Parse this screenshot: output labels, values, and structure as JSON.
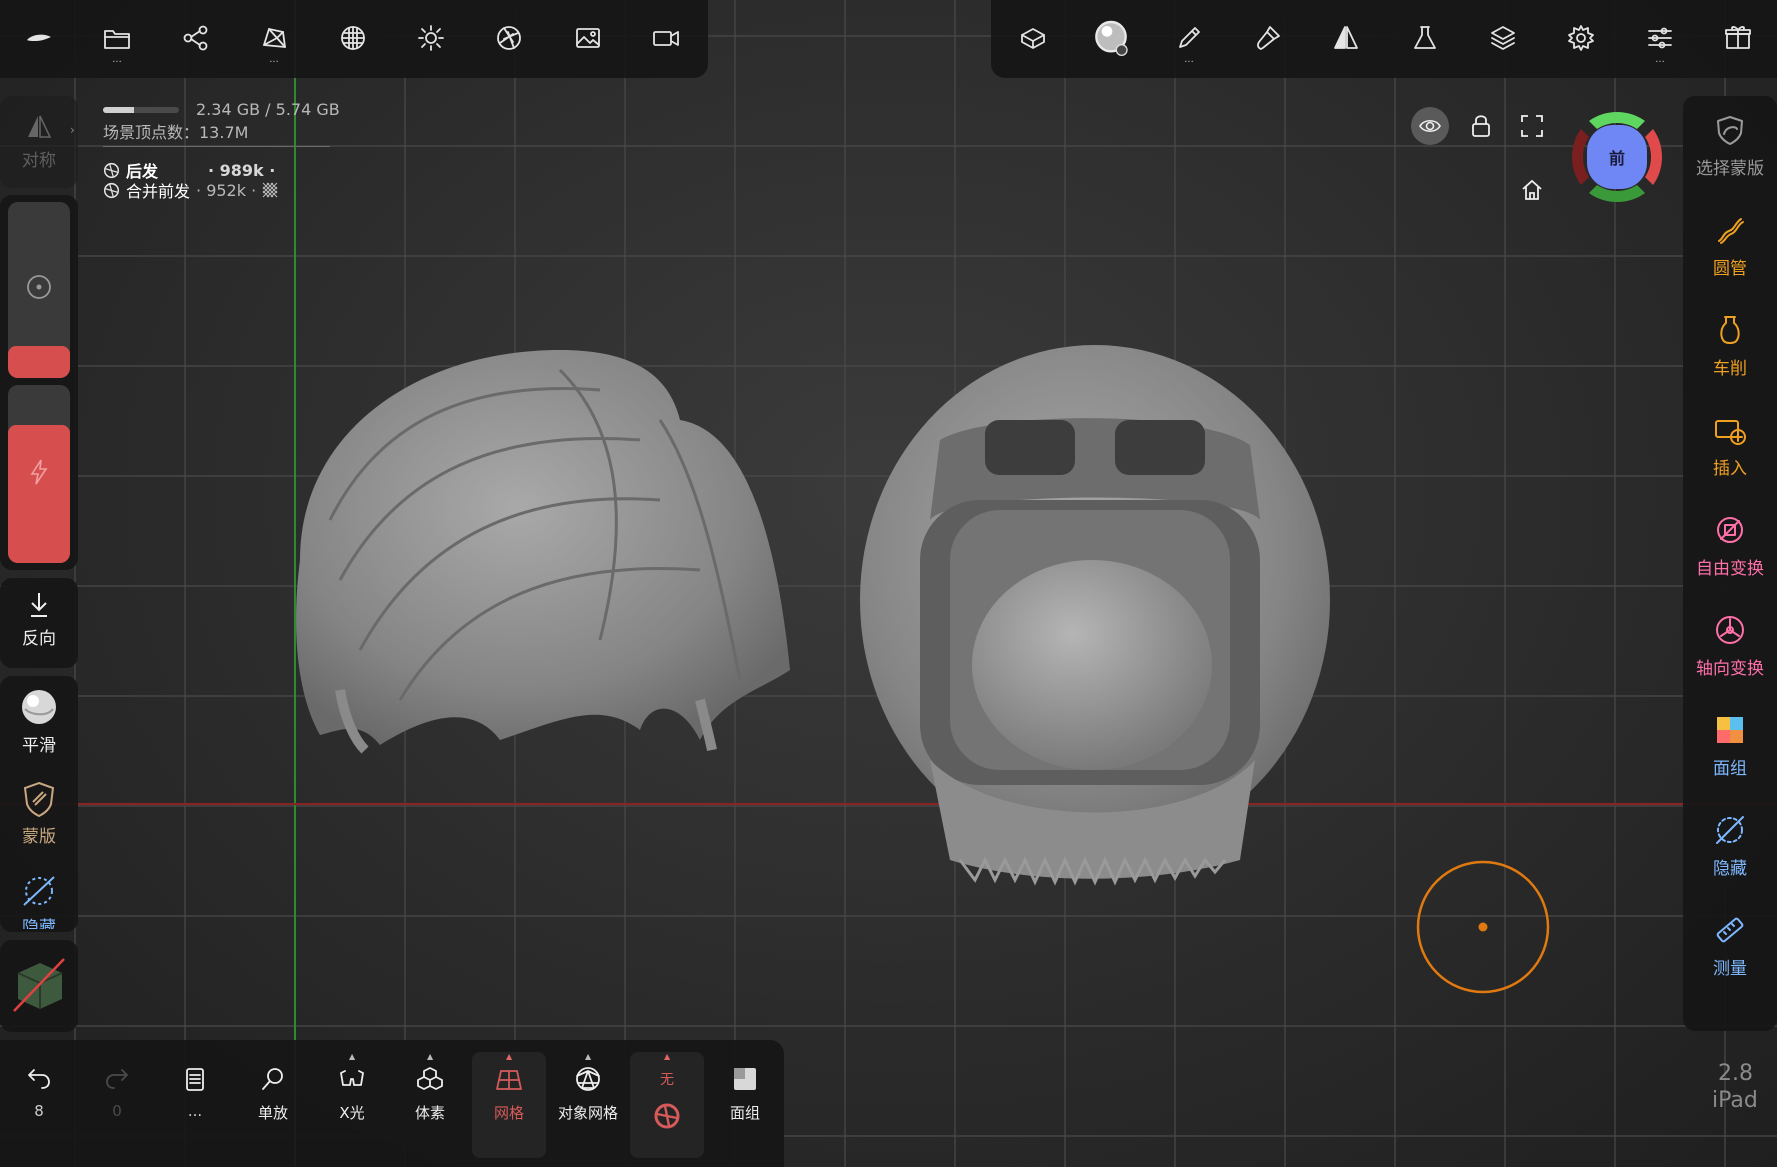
{
  "memory": {
    "text": "2.34 GB / 5.74 GB",
    "used_fraction": 0.41
  },
  "scene_vertices": "场景顶点数：13.7M",
  "meshes": [
    {
      "name": "后发",
      "count": "· 989k ·"
    },
    {
      "name": "合并前发",
      "count": "· 952k ·"
    }
  ],
  "left": {
    "symmetry": "对称",
    "invert": "反向",
    "smooth": "平滑",
    "mask": "蒙版",
    "hide_partial": "隐藏"
  },
  "right_tools": [
    {
      "label": "选择蒙版",
      "icon": "select-mask-icon",
      "color": "#9a9a9a"
    },
    {
      "label": "圆管",
      "icon": "tube-icon",
      "color": "#f0a020"
    },
    {
      "label": "车削",
      "icon": "lathe-icon",
      "color": "#f0a020"
    },
    {
      "label": "插入",
      "icon": "insert-icon",
      "color": "#f0a020"
    },
    {
      "label": "自由变换",
      "icon": "free-transform-icon",
      "color": "#ff6fa8"
    },
    {
      "label": "轴向变换",
      "icon": "axis-transform-icon",
      "color": "#ff6fa8"
    },
    {
      "label": "面组",
      "icon": "face-group-icon",
      "color": "#7db8ff"
    },
    {
      "label": "隐藏",
      "icon": "hide-icon",
      "color": "#7db8ff"
    },
    {
      "label": "测量",
      "icon": "measure-icon",
      "color": "#7db8ff"
    }
  ],
  "bottom": {
    "undo_count": "8",
    "redo_count": "0",
    "more": "...",
    "solo": "单放",
    "xray": "X光",
    "voxel": "体素",
    "wireframe": "网格",
    "object_wire": "对象网格",
    "none": "无",
    "face_group": "面组"
  },
  "gizmo_label": "前",
  "version": {
    "number": "2.8",
    "device": "iPad"
  },
  "colors": {
    "accent_orange": "#e07a10",
    "accent_red": "#d64e4e",
    "axis_x": "#b83030",
    "axis_y": "#3a9a3a",
    "gizmo_blue": "#6f86f5"
  }
}
